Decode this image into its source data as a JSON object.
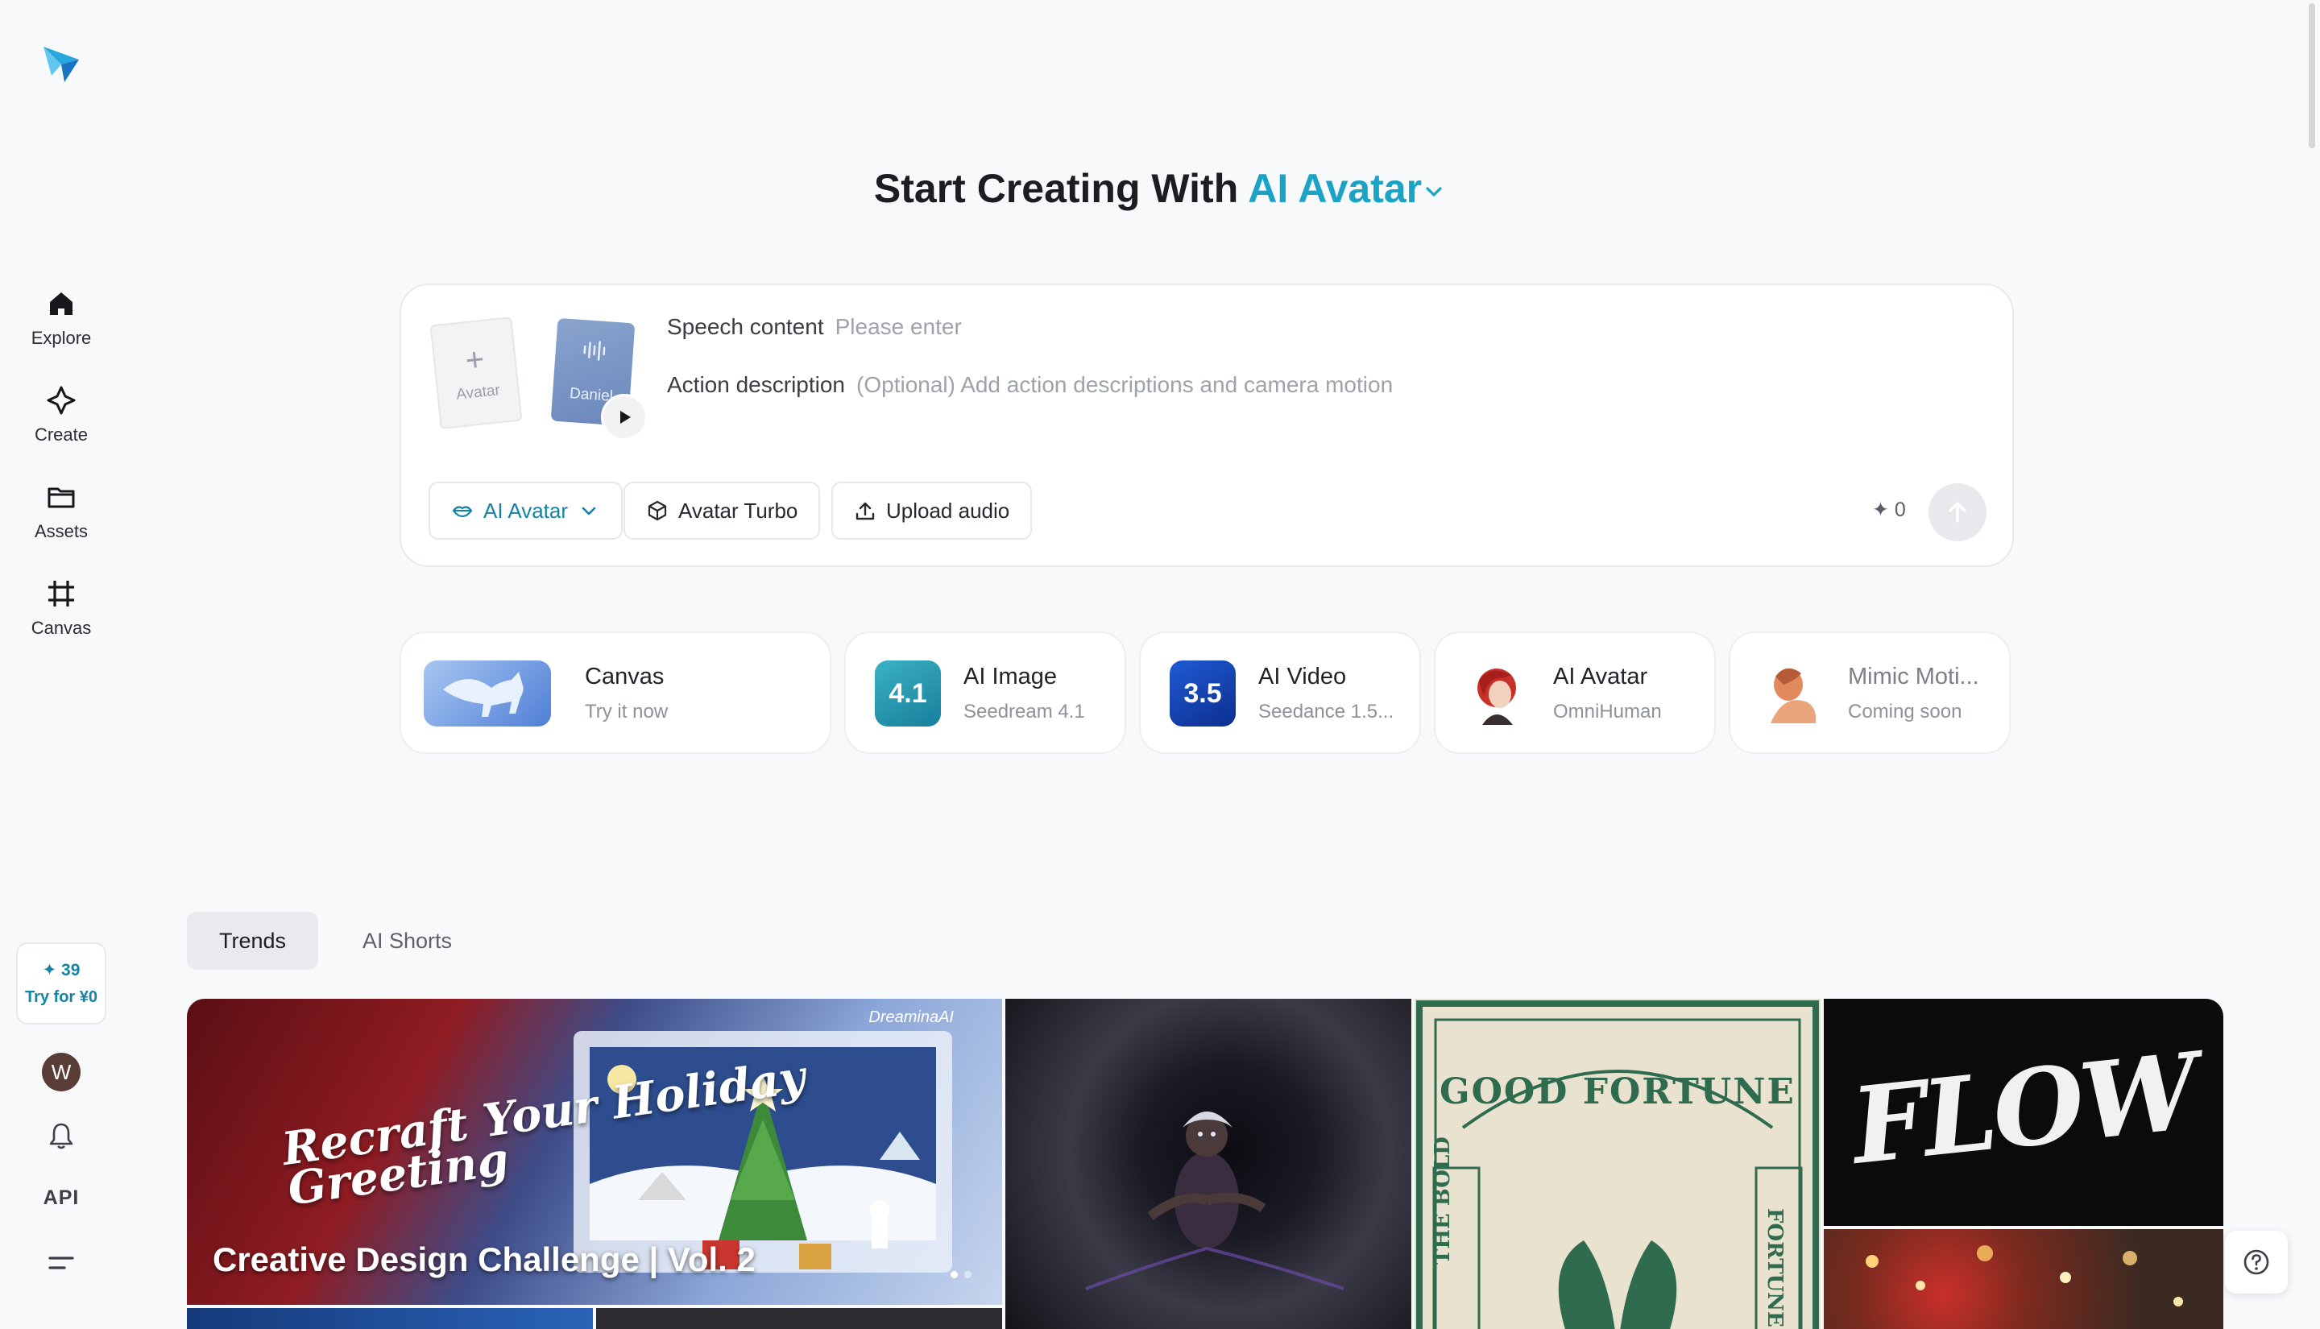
{
  "sidebar": {
    "items": [
      {
        "label": "Explore",
        "icon": "home-icon"
      },
      {
        "label": "Create",
        "icon": "sparkle-icon"
      },
      {
        "label": "Assets",
        "icon": "folder-icon"
      },
      {
        "label": "Canvas",
        "icon": "crop-icon"
      }
    ],
    "credits": "✦ 39",
    "try_label": "Try for ¥0",
    "avatar_initial": "W",
    "api_label": "API"
  },
  "heading": {
    "prefix": "Start Creating With",
    "mode": "AI Avatar"
  },
  "prompt": {
    "avatar_slot_label": "Avatar",
    "voice_label": "Daniel",
    "speech_label": "Speech content",
    "speech_placeholder": "Please enter",
    "action_label": "Action description",
    "action_placeholder": "(Optional) Add action descriptions and camera motion",
    "mode_chip": "AI Avatar",
    "model_chip": "Avatar Turbo",
    "upload_chip": "Upload audio",
    "cost": "0"
  },
  "tools": [
    {
      "name": "Canvas",
      "sub": "Try it now"
    },
    {
      "name": "AI Image",
      "sub": "Seedream 4.1",
      "badge": "4.1"
    },
    {
      "name": "AI Video",
      "sub": "Seedance 1.5...",
      "badge": "3.5"
    },
    {
      "name": "AI Avatar",
      "sub": "OmniHuman"
    },
    {
      "name": "Mimic Moti...",
      "sub": "Coming soon"
    }
  ],
  "tabs": [
    "Trends",
    "AI Shorts"
  ],
  "gallery": {
    "banner_title": "Creative Design Challenge | Vol. 2",
    "banner_script": "Recraft Your Holiday Greeting",
    "brand": "DreaminaAI",
    "fortune_text": "GOOD FORTUNE",
    "fortune_side_left": "THE BOLD",
    "fortune_side_right": "FORTUNE",
    "flow_text": "FLOW"
  },
  "colors": {
    "accent": "#1ba3c6",
    "background": "#f8f9fb"
  }
}
